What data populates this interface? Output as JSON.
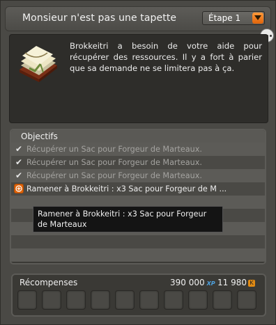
{
  "quest": {
    "title": "Monsieur n'est pas une tapette",
    "step_label": "Étape 1",
    "description": "Brokkeitri a besoin de votre aide pour récupérer des ressources. Il y a fort à parier que sa demande ne se limitera pas à ça."
  },
  "objectives": {
    "header": "Objectifs",
    "items": [
      {
        "label": "Récupérer un Sac pour Forgeur de Marteaux.",
        "done": true
      },
      {
        "label": "Récupérer un Sac pour Forgeur de Marteaux.",
        "done": true
      },
      {
        "label": "Récupérer un Sac pour Forgeur de Marteaux.",
        "done": true
      },
      {
        "label": "Ramener à Brokkeitri : x3 Sac pour Forgeur de M ...",
        "done": false
      }
    ],
    "tooltip": "Ramener à Brokkeitri : x3 Sac pour Forgeur de Marteaux"
  },
  "rewards": {
    "title": "Récompenses",
    "xp": "390 000",
    "xp_unit": "XP",
    "kamas": "11 980",
    "kamas_unit": "K",
    "slot_count": 10
  },
  "icons": {
    "quest_icon": "book-scroll-icon",
    "done": "checkmark-icon",
    "active": "target-icon",
    "menu": "more-options-icon",
    "dropdown": "chevron-down-icon"
  },
  "colors": {
    "accent": "#e0640a",
    "xp": "#4ea2e0",
    "kamas": "#e08a13"
  }
}
